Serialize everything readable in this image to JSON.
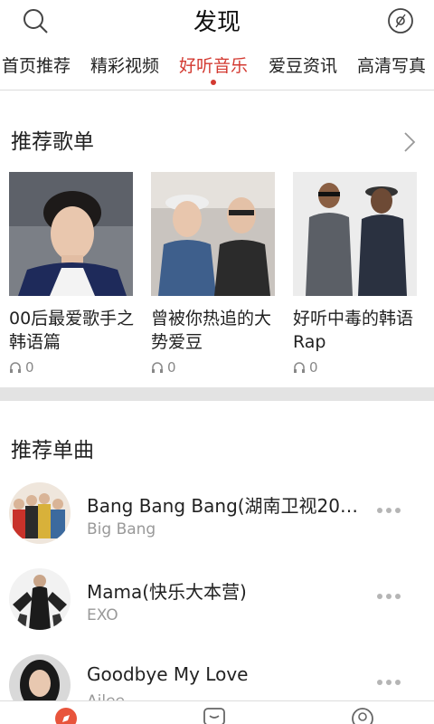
{
  "header": {
    "title": "发现",
    "left_icon": "search-icon",
    "right_icon": "disc-icon"
  },
  "tabs": [
    {
      "label": "首页推荐"
    },
    {
      "label": "精彩视频"
    },
    {
      "label": "好听音乐",
      "active": true
    },
    {
      "label": "爱豆资讯"
    },
    {
      "label": "高清写真"
    }
  ],
  "playlists_section": {
    "title": "推荐歌单",
    "more_icon": "chevron-right-icon"
  },
  "playlists": [
    {
      "name": "00后最爱歌手之韩语篇",
      "plays": "0"
    },
    {
      "name": "曾被你热追的大势爱豆",
      "plays": "0"
    },
    {
      "name": "好听中毒的韩语Rap",
      "plays": "0"
    }
  ],
  "songs_section": {
    "title": "推荐单曲"
  },
  "songs": [
    {
      "title": "Bang Bang Bang(湖南卫视20…",
      "artist": "Big Bang"
    },
    {
      "title": "Mama(快乐大本营)",
      "artist": "EXO"
    },
    {
      "title": "Goodbye My Love",
      "artist": "Ailee"
    }
  ],
  "colors": {
    "accent": "#d33a31",
    "divider": "#e3e3e3",
    "muted": "#999999"
  },
  "bottom_bar_icons": [
    "discover-icon",
    "message-icon",
    "profile-icon"
  ]
}
